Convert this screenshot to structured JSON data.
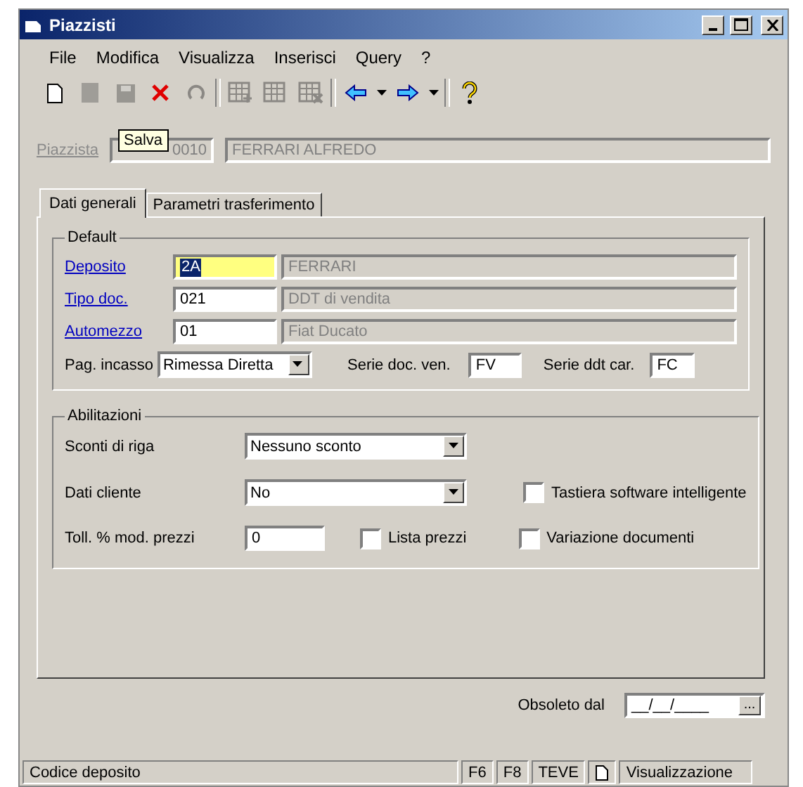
{
  "window": {
    "title": "Piazzisti"
  },
  "menu": [
    "File",
    "Modifica",
    "Visualizza",
    "Inserisci",
    "Query",
    "?"
  ],
  "toolbar": [
    {
      "kind": "new",
      "disabled": false
    },
    {
      "kind": "doc",
      "disabled": true
    },
    {
      "kind": "save",
      "disabled": true
    },
    {
      "kind": "delete",
      "disabled": false
    },
    {
      "kind": "undo",
      "disabled": true
    },
    {
      "kind": "sep"
    },
    {
      "kind": "grid-add",
      "disabled": true
    },
    {
      "kind": "grid",
      "disabled": true
    },
    {
      "kind": "grid-del",
      "disabled": true
    },
    {
      "kind": "sep"
    },
    {
      "kind": "back",
      "disabled": false
    },
    {
      "kind": "drop",
      "disabled": false
    },
    {
      "kind": "forward",
      "disabled": false
    },
    {
      "kind": "drop",
      "disabled": false
    },
    {
      "kind": "sep"
    },
    {
      "kind": "help",
      "disabled": false
    }
  ],
  "tooltip": "Salva",
  "header": {
    "label": "Piazzista",
    "disabled": true,
    "code": "0010",
    "name": "FERRARI ALFREDO"
  },
  "tabs": [
    {
      "label": "Dati generali",
      "selected": true
    },
    {
      "label": "Parametri trasferimento",
      "selected": false
    }
  ],
  "default_group": {
    "title": "Default",
    "rows": [
      {
        "label": "Deposito",
        "code": "2A",
        "focused": true,
        "description": "FERRARI"
      },
      {
        "label": "Tipo doc.",
        "code": "021",
        "focused": false,
        "description": "DDT di vendita"
      },
      {
        "label": "Automezzo",
        "code": "01",
        "focused": false,
        "description": "Fiat Ducato"
      }
    ],
    "payment": {
      "label": "Pag. incasso",
      "value": "Rimessa Diretta"
    },
    "series_sales": {
      "label": "Serie doc. ven.",
      "value": "FV"
    },
    "series_load": {
      "label": "Serie ddt car.",
      "value": "FC"
    }
  },
  "abilitazioni": {
    "title": "Abilitazioni",
    "sconti": {
      "label": "Sconti di riga",
      "value": "Nessuno sconto"
    },
    "dati_cliente": {
      "label": "Dati cliente",
      "value": "No"
    },
    "tolleranza": {
      "label": "Toll. % mod. prezzi",
      "value": "0"
    },
    "checkboxes": [
      {
        "label": "Tastiera software intelligente",
        "checked": false
      },
      {
        "label": "Lista prezzi",
        "checked": false
      },
      {
        "label": "Variazione documenti",
        "checked": false
      }
    ]
  },
  "obsoleto": {
    "label": "Obsoleto dal",
    "value": "__/__/____",
    "button": "..."
  },
  "status_bar": [
    "Codice deposito",
    "F6",
    "F8",
    "TEVE",
    "Visualizzazione"
  ]
}
